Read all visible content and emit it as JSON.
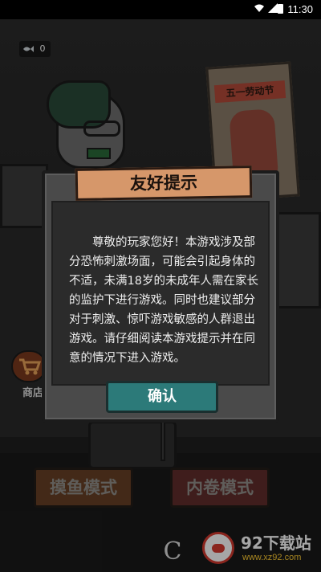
{
  "status_bar": {
    "time": "11:30",
    "icons": [
      "wifi-icon",
      "signal-icon",
      "battery-icon"
    ]
  },
  "hud": {
    "fish_count": "0",
    "fish_icon": "fish-icon"
  },
  "scene": {
    "poster_title": "五一劳动节"
  },
  "shop": {
    "label": "商店",
    "icon": "cart-icon"
  },
  "modes": {
    "fish_label": "摸鱼模式",
    "rat_label": "内卷模式"
  },
  "dialog": {
    "title": "友好提示",
    "body": "尊敬的玩家您好！本游戏涉及部分恐怖刺激场面，可能会引起身体的不适，未满18岁的未成年人需在家长的监护下进行游戏。同时也建议部分对于刺激、惊吓游戏敏感的人群退出游戏。请仔细阅读本游戏提示并在同意的情况下进入游戏。",
    "confirm_label": "确认"
  },
  "watermark": {
    "brand": "92下载站",
    "url": "www.xz92.com",
    "corner_glyph": "C"
  },
  "colors": {
    "dialog_title_bg": "#d6976a",
    "confirm_bg": "#2c7a79",
    "fish_mode_bg": "#a6602e",
    "rat_mode_bg": "#9b3d3a"
  }
}
